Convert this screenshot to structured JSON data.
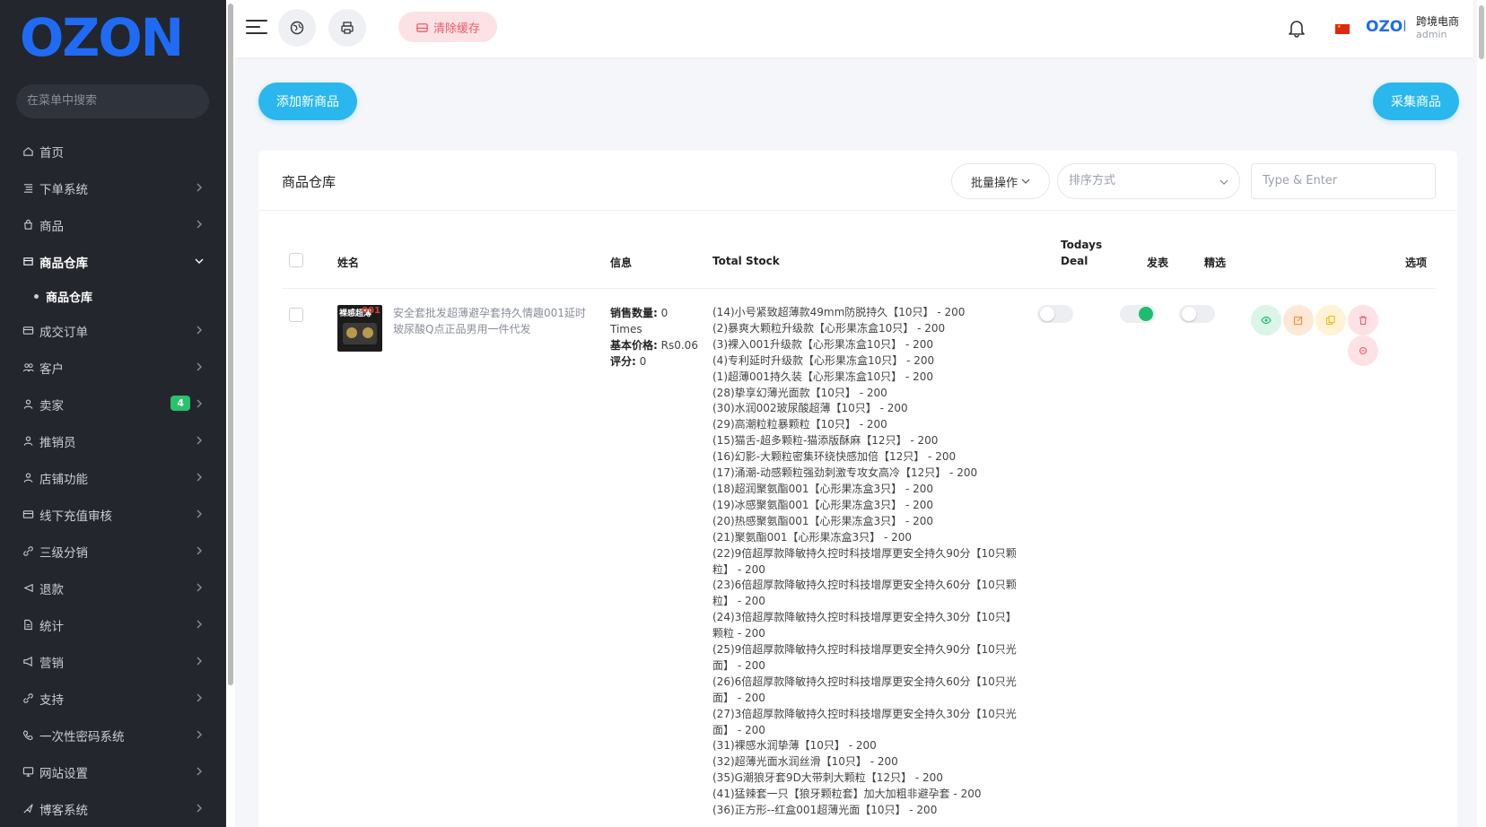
{
  "sidebar": {
    "logo_text": "OZON",
    "search_placeholder": "在菜单中搜索",
    "items": [
      {
        "label": "首页",
        "icon": "home-icon"
      },
      {
        "label": "下单系统",
        "icon": "list-icon"
      },
      {
        "label": "商品",
        "icon": "bag-icon"
      },
      {
        "label": "商品仓库",
        "icon": "warehouse-icon",
        "active": true
      },
      {
        "label": "商品仓库",
        "sub": true
      },
      {
        "label": "成交订单",
        "icon": "card-icon"
      },
      {
        "label": "客户",
        "icon": "users-icon"
      },
      {
        "label": "卖家",
        "icon": "user-icon",
        "badge": "4"
      },
      {
        "label": "推销员",
        "icon": "user-icon"
      },
      {
        "label": "店铺功能",
        "icon": "user-icon"
      },
      {
        "label": "线下充值审核",
        "icon": "card-icon"
      },
      {
        "label": "三级分销",
        "icon": "link-icon"
      },
      {
        "label": "退款",
        "icon": "back-icon"
      },
      {
        "label": "统计",
        "icon": "file-icon"
      },
      {
        "label": "营销",
        "icon": "megaphone-icon"
      },
      {
        "label": "支持",
        "icon": "link-icon"
      },
      {
        "label": "一次性密码系统",
        "icon": "phone-icon"
      },
      {
        "label": "网站设置",
        "icon": "monitor-icon"
      },
      {
        "label": "博客系统",
        "icon": "share-icon"
      }
    ]
  },
  "topbar": {
    "clear_cache": "清除缓存",
    "brand_mini": "OZON",
    "user_name": "跨境电商",
    "user_role": "admin",
    "flag_color": "#de2910"
  },
  "actions": {
    "add_product": "添加新商品",
    "collect_product": "采集商品"
  },
  "card": {
    "title": "商品仓库",
    "bulk_action": "批量操作",
    "sort_placeholder": "排序方式",
    "search_placeholder": "Type & Enter"
  },
  "table": {
    "headers": {
      "name": "姓名",
      "info": "信息",
      "stock": "Total Stock",
      "deal_line1": "Todays",
      "deal_line2": "Deal",
      "publish": "发表",
      "featured": "精选",
      "options": "选项"
    },
    "row": {
      "image_tag": "裸感超薄",
      "image_num": "001",
      "name": "安全套批发超薄避孕套持久情趣001延时玻尿酸Q点正品男用一件代发",
      "info": {
        "sales_label": "销售数量:",
        "sales_value": "0",
        "times": "Times",
        "price_label": "基本价格:",
        "price_value": "Rs0.06",
        "rating_label": "评分:",
        "rating_value": "0"
      },
      "stock": [
        "(14)小号紧致超薄款49mm防脱持久【10只】 - 200",
        "(2)暴爽大颗粒升级款【心形果冻盒10只】 - 200",
        "(3)裸入001升级款【心形果冻盒10只】 - 200",
        "(4)专利延时升级款【心形果冻盒10只】 - 200",
        "(1)超薄001持久装【心形果冻盒10只】 - 200",
        "(28)挚享幻薄光面款【10只】 - 200",
        "(30)水润002玻尿酸超薄【10只】 - 200",
        "(29)高潮粒粒暴颗粒【10只】 - 200",
        "(15)猫舌-超多颗粒-猫添版酥麻【12只】 - 200",
        "(16)幻影-大颗粒密集环绕快感加倍【12只】 - 200",
        "(17)涌潮-动感颗粒强劲刺激专攻女高冷【12只】 - 200",
        "(18)超润聚氨酯001【心形果冻盒3只】 - 200",
        "(19)冰感聚氨酯001【心形果冻盒3只】 - 200",
        "(20)热感聚氨酯001【心形果冻盒3只】 - 200",
        "(21)聚氨酯001【心形果冻盒3只】 - 200",
        "(22)9倍超厚款降敏持久控时科技增厚更安全持久90分【10只颗粒】 - 200",
        "(23)6倍超厚款降敏持久控时科技增厚更安全持久60分【10只颗粒】 - 200",
        "(24)3倍超厚款降敏持久控时科技增厚更安全持久30分【10只】颗粒 - 200",
        "(25)9倍超厚款降敏持久控时科技增厚更安全持久90分【10只光面】 - 200",
        "(26)6倍超厚款降敏持久控时科技增厚更安全持久60分【10只光面】 - 200",
        "(27)3倍超厚款降敏持久控时科技增厚更安全持久30分【10只光面】 - 200",
        "(31)裸感水润挚薄【10只】 - 200",
        "(32)超薄光面水润丝滑【10只】 - 200",
        "(35)G潮狼牙套9D大带刺大颗粒【12只】 - 200",
        "(41)猛辣套一只【狼牙颗粒套】加大加粗非避孕套 - 200",
        "(36)正方形--红盒001超薄光面【10只】 - 200"
      ],
      "todays_deal": false,
      "published": true,
      "featured": false
    }
  },
  "colors": {
    "accent": "#2ab7ee",
    "sidebar_bg": "#23262d",
    "green": "#1dbd71",
    "danger": "#f05a6b"
  }
}
